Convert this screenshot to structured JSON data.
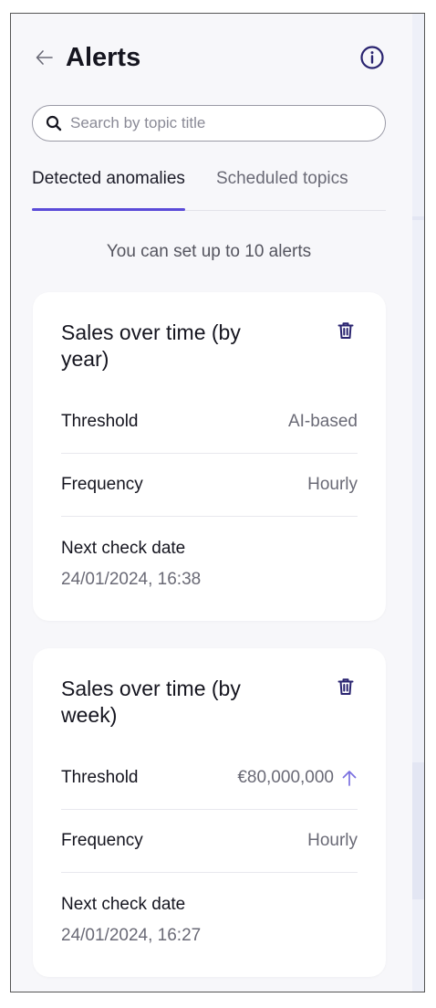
{
  "header": {
    "title": "Alerts"
  },
  "search": {
    "placeholder": "Search by topic title"
  },
  "tabs": [
    {
      "label": "Detected anomalies",
      "active": true
    },
    {
      "label": "Scheduled topics",
      "active": false
    }
  ],
  "limit_note": "You can set up to 10 alerts",
  "alerts": [
    {
      "title": "Sales over time (by year)",
      "threshold_label": "Threshold",
      "threshold_value": "AI-based",
      "frequency_label": "Frequency",
      "frequency_value": "Hourly",
      "next_check_label": "Next check date",
      "next_check_value": "24/01/2024, 16:38"
    },
    {
      "title": "Sales over time (by week)",
      "threshold_label": "Threshold",
      "threshold_value": "€80,000,000",
      "threshold_direction": "up",
      "frequency_label": "Frequency",
      "frequency_value": "Hourly",
      "next_check_label": "Next check date",
      "next_check_value": "24/01/2024, 16:27"
    }
  ],
  "colors": {
    "accent": "#5b4bd8",
    "info_icon": "#2a2470",
    "trash_icon": "#2a2470",
    "arrow_icon": "#7a70e0"
  },
  "icons": {
    "back": "arrow-left-icon",
    "info": "info-circle-icon",
    "search": "search-icon",
    "delete": "trash-icon",
    "threshold_up": "arrow-up-icon"
  }
}
